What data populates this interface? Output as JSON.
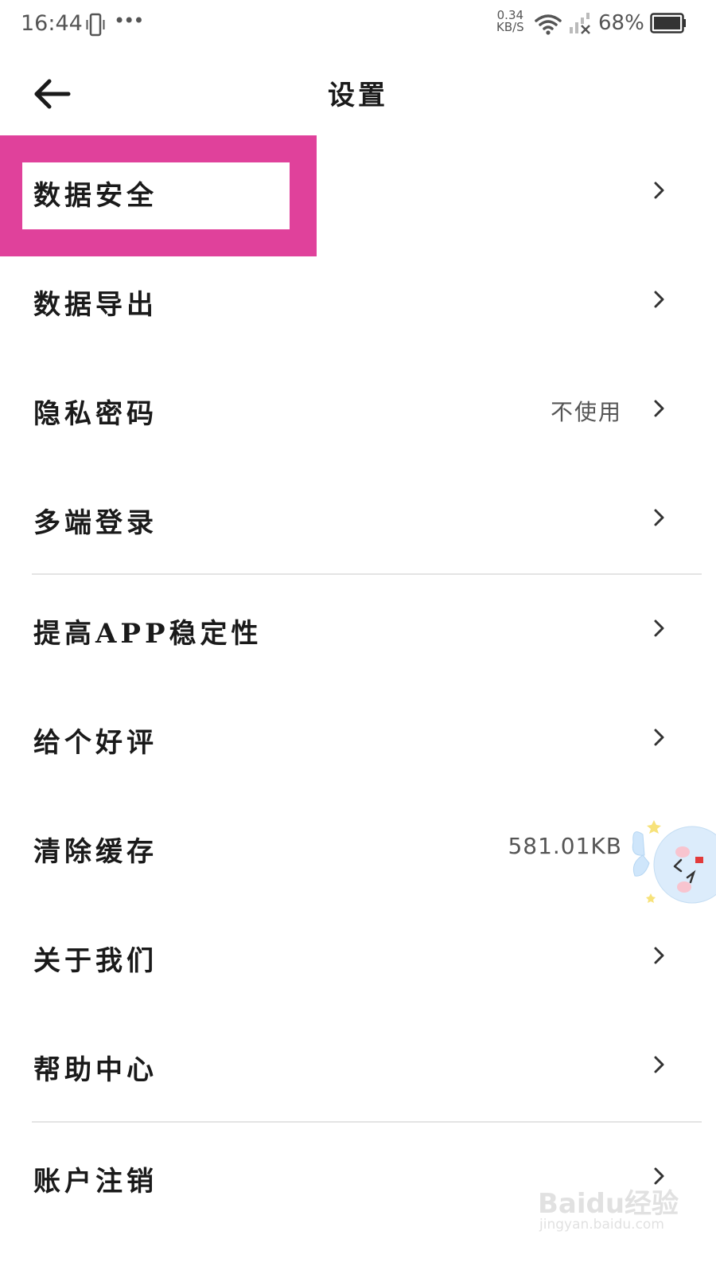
{
  "status_bar": {
    "time": "16:44",
    "dots": "•••",
    "speed_value": "0.34",
    "speed_unit": "KB/S",
    "battery": "68%"
  },
  "header": {
    "back_icon": "arrow-left-icon",
    "title": "设置"
  },
  "highlight_color": "#e0419b",
  "settings": [
    {
      "label": "数据安全",
      "value": "",
      "icon": "chevron-right-icon"
    },
    {
      "label": "数据导出",
      "value": "",
      "icon": "chevron-right-icon"
    },
    {
      "label": "隐私密码",
      "value": "不使用",
      "icon": "chevron-right-icon"
    },
    {
      "label": "多端登录",
      "value": "",
      "icon": "chevron-right-icon"
    },
    {
      "label": "提高APP稳定性",
      "value": "",
      "icon": "chevron-right-icon"
    },
    {
      "label": "给个好评",
      "value": "",
      "icon": "chevron-right-icon"
    },
    {
      "label": "清除缓存",
      "value": "581.01KB",
      "icon": ""
    },
    {
      "label": "关于我们",
      "value": "",
      "icon": "chevron-right-icon"
    },
    {
      "label": "帮助中心",
      "value": "",
      "icon": "chevron-right-icon"
    },
    {
      "label": "账户注销",
      "value": "",
      "icon": "chevron-right-icon"
    }
  ],
  "watermark": {
    "logo": "Baidu经验",
    "url": "jingyan.baidu.com"
  }
}
